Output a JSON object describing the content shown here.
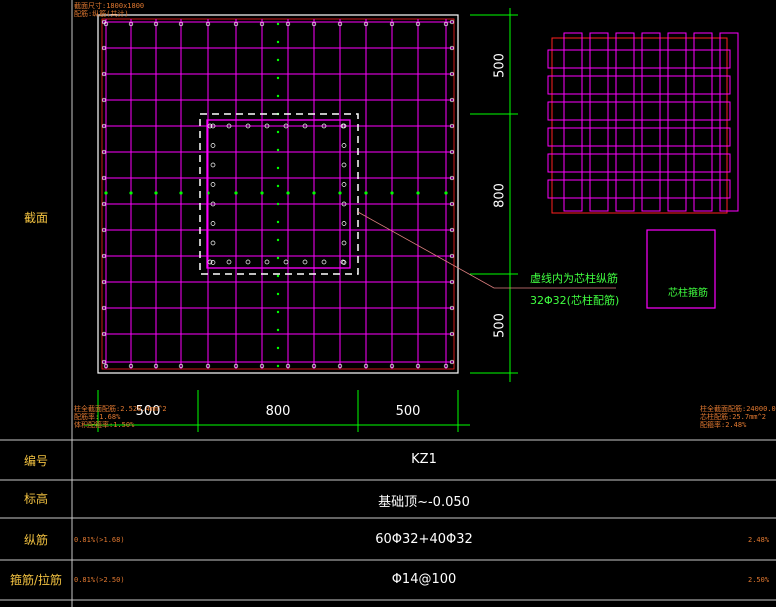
{
  "table": {
    "row_labels": [
      "截面",
      "编号",
      "标高",
      "纵筋",
      "箍筋/拉筋"
    ],
    "id": "KZ1",
    "elevation": "基础顶~-0.050",
    "longitudinal": "60Φ32+40Φ32",
    "stirrup": "Φ14@100",
    "long_ratio_left": "0.81%(>1.68)",
    "long_ratio_right": "2.48%",
    "stir_ratio_left": "0.81%(>2.50)",
    "stir_ratio_right": "2.50%"
  },
  "section": {
    "dim_bottom": [
      "500",
      "800",
      "500"
    ],
    "dim_right": [
      "500",
      "800",
      "500"
    ],
    "callout_line1": "虚线内为芯柱纵筋",
    "callout_line2": "32Φ32(芯柱配筋)",
    "core_label": "芯柱箍筋"
  },
  "notes": {
    "left": [
      "柱全截面配筋:2.528.4mm^2",
      "配筋率:1.68%",
      "体积配箍率:1.50%"
    ],
    "right": [
      "柱全截面配筋:24000.0mm^2",
      "芯柱配筋:25.7mm^2",
      "配箍率:2.48%"
    ],
    "top": [
      "截面尺寸:1800x1800",
      "配筋:纵筋(共计)"
    ]
  },
  "colors": {
    "background": "#000000",
    "grid": "#ff00ff",
    "outline": "#ffffff",
    "dims": "#00ff00",
    "text": "#f0c040",
    "border_red": "#ff2020"
  }
}
